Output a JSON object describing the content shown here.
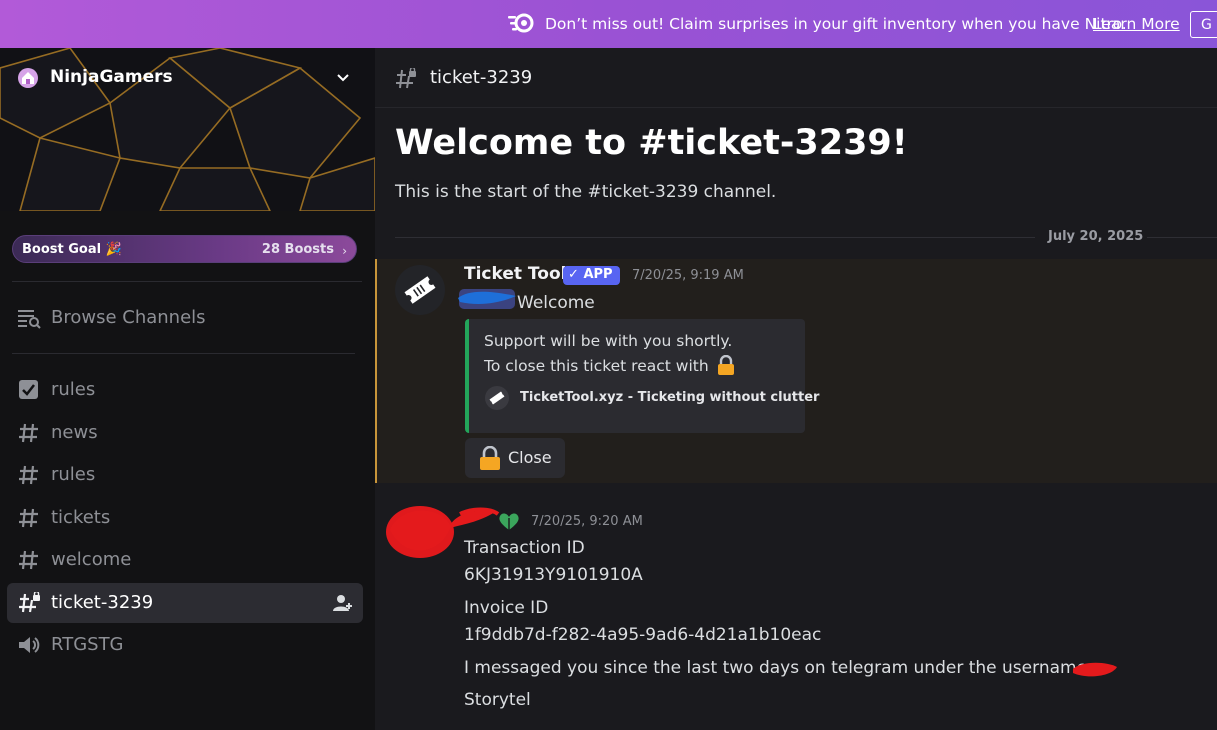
{
  "banner": {
    "text": "Don’t miss out! Claim surprises in your gift inventory when you have Nitro.",
    "link": "Learn More",
    "button": "G"
  },
  "sidebar": {
    "server_name": "NinjaGamers",
    "boost_label": "Boost Goal 🎉",
    "boost_count": "28 Boosts",
    "browse_label": "Browse Channels",
    "channels": [
      {
        "label": "rules",
        "icon": "rules-icon"
      },
      {
        "label": "news",
        "icon": "hashtag-icon"
      },
      {
        "label": "rules",
        "icon": "hashtag-icon"
      },
      {
        "label": "tickets",
        "icon": "hashtag-icon"
      },
      {
        "label": "welcome",
        "icon": "hashtag-icon"
      },
      {
        "label": "ticket-3239",
        "icon": "locked-hashtag-icon",
        "active": true
      },
      {
        "label": "RTGSTG",
        "icon": "speaker-icon"
      }
    ]
  },
  "channel": {
    "name": "ticket-3239",
    "welcome_title": "Welcome to #ticket-3239!",
    "welcome_sub": "This is the start of the #ticket-3239 channel.",
    "date_divider": "July 20, 2025"
  },
  "messages": [
    {
      "author": "Ticket Tool",
      "badge": "APP",
      "time": "7/20/25, 9:19 AM",
      "text": "Welcome",
      "embed": {
        "line1": "Support will be with you shortly.",
        "line2": "To close this ticket react with",
        "footer": "TicketTool.xyz - Ticketing without clutter"
      },
      "button": "Close"
    },
    {
      "time": "7/20/25, 9:20 AM",
      "lines": [
        "Transaction ID",
        "6KJ31913Y9101910A",
        "Invoice ID",
        "1f9ddb7d-f282-4a95-9ad6-4d21a1b10eac",
        "I messaged you since the last two days on telegram under the username",
        "Storytel"
      ]
    }
  ],
  "colors": {
    "accent": "#5865f2",
    "highlight_border": "#c8953a",
    "embed_border": "#23a55a"
  }
}
